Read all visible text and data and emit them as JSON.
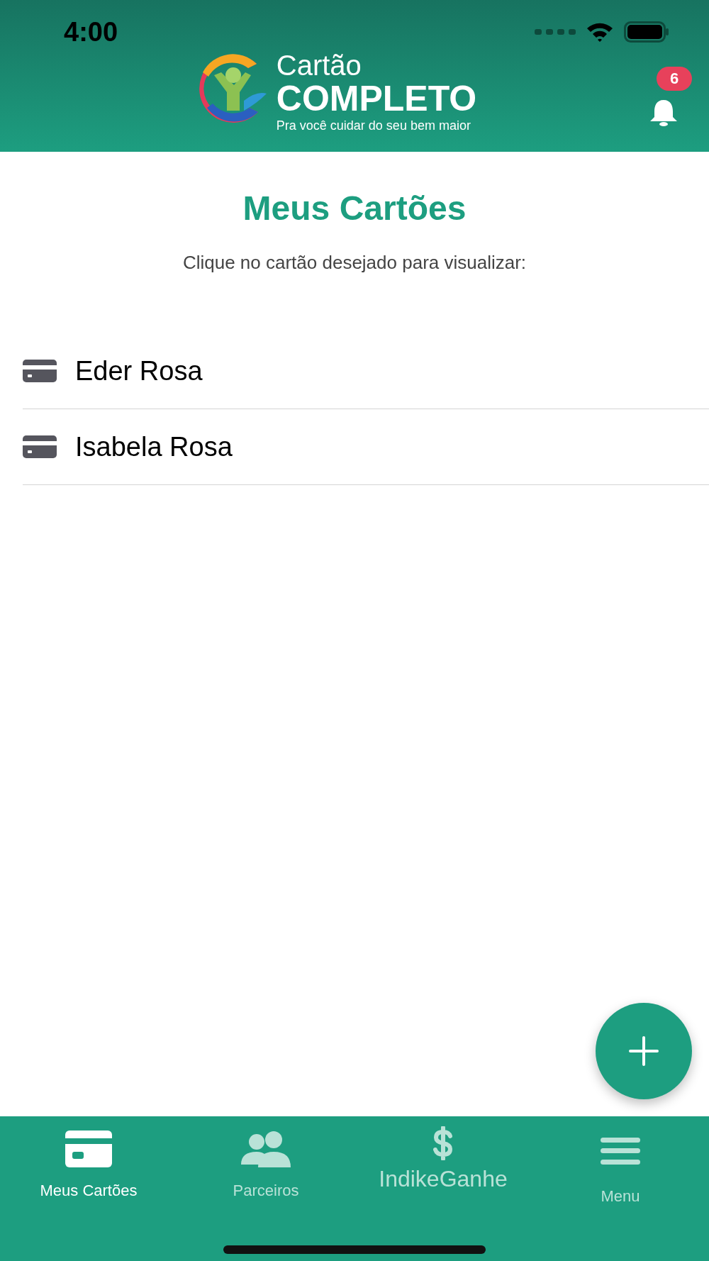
{
  "status_bar": {
    "time": "4:00"
  },
  "header": {
    "logo_line_1": "Cartão",
    "logo_line_2": "COMPLETO",
    "logo_tagline": "Pra você cuidar do seu bem maior",
    "notification_count": "6"
  },
  "title": "Meus Cartões",
  "subtitle": "Clique no cartão desejado para visualizar:",
  "cards": [
    {
      "name": "Eder Rosa"
    },
    {
      "name": "Isabela Rosa"
    }
  ],
  "tabs": [
    {
      "label": "Meus Cartões",
      "kind": "card",
      "selected": true
    },
    {
      "label": "Parceiros",
      "kind": "people",
      "selected": false
    },
    {
      "label": "IndikeGanhe",
      "kind": "dollar",
      "selected": false
    },
    {
      "label": "Menu",
      "kind": "menu",
      "selected": false
    }
  ]
}
